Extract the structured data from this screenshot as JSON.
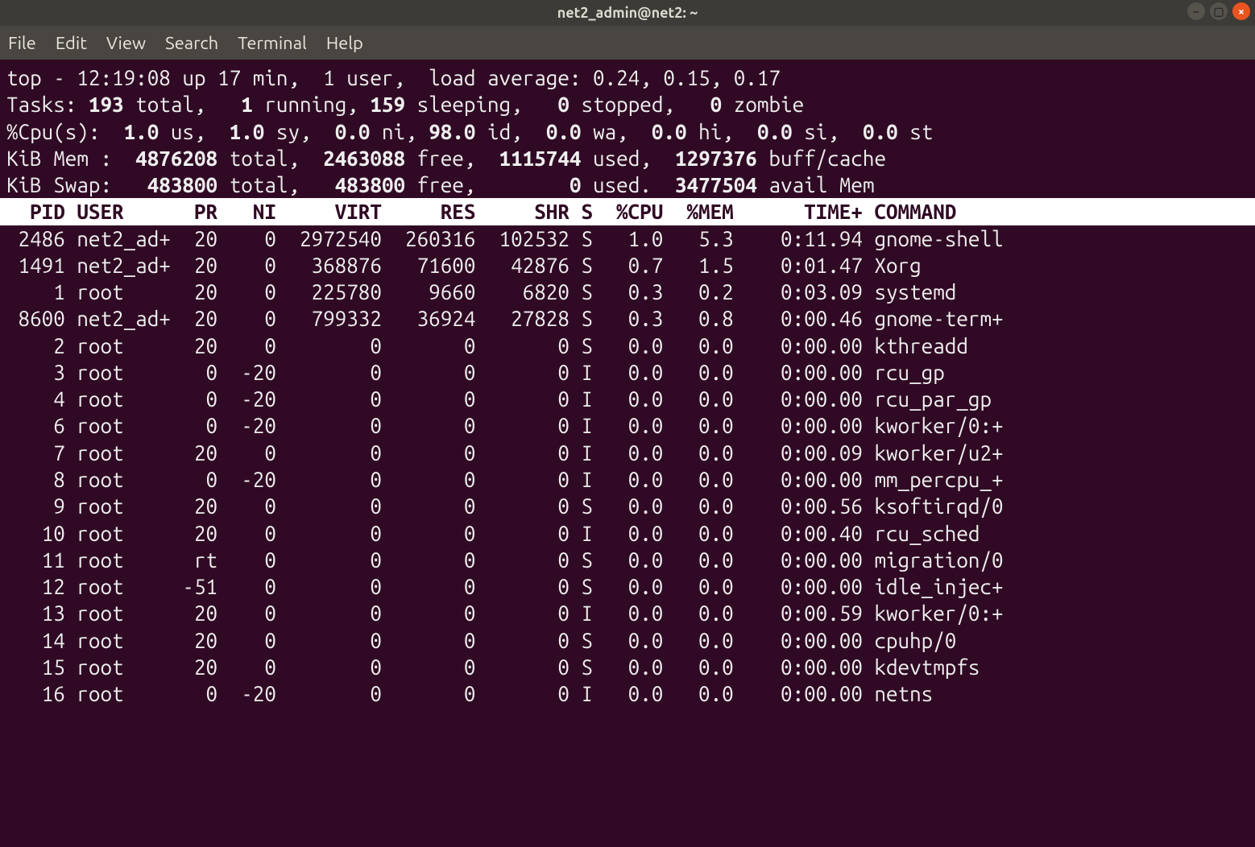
{
  "window": {
    "title": "net2_admin@net2: ~",
    "controls": {
      "minimize_tooltip": "Minimize",
      "maximize_tooltip": "Maximize",
      "close_tooltip": "Close"
    }
  },
  "menubar": [
    "File",
    "Edit",
    "View",
    "Search",
    "Terminal",
    "Help"
  ],
  "top": {
    "summary": {
      "time": "12:19:08",
      "uptime": "17 min",
      "users": "1",
      "load_avg": [
        "0.24",
        "0.15",
        "0.17"
      ]
    },
    "tasks": {
      "total": "193",
      "running": "1",
      "sleeping": "159",
      "stopped": "0",
      "zombie": "0"
    },
    "cpu": {
      "us": "1.0",
      "sy": "1.0",
      "ni": "0.0",
      "id": "98.0",
      "wa": "0.0",
      "hi": "0.0",
      "si": "0.0",
      "st": "0.0"
    },
    "mem": {
      "total": "4876208",
      "free": "2463088",
      "used": "1115744",
      "buff_cache": "1297376"
    },
    "swap": {
      "total": "483800",
      "free": "483800",
      "used": "0",
      "avail_mem": "3477504"
    },
    "columns": [
      "PID",
      "USER",
      "PR",
      "NI",
      "VIRT",
      "RES",
      "SHR",
      "S",
      "%CPU",
      "%MEM",
      "TIME+",
      "COMMAND"
    ],
    "processes": [
      {
        "pid": "2486",
        "user": "net2_ad+",
        "pr": "20",
        "ni": "0",
        "virt": "2972540",
        "res": "260316",
        "shr": "102532",
        "s": "S",
        "cpu": "1.0",
        "mem": "5.3",
        "time": "0:11.94",
        "command": "gnome-shell"
      },
      {
        "pid": "1491",
        "user": "net2_ad+",
        "pr": "20",
        "ni": "0",
        "virt": "368876",
        "res": "71600",
        "shr": "42876",
        "s": "S",
        "cpu": "0.7",
        "mem": "1.5",
        "time": "0:01.47",
        "command": "Xorg"
      },
      {
        "pid": "1",
        "user": "root",
        "pr": "20",
        "ni": "0",
        "virt": "225780",
        "res": "9660",
        "shr": "6820",
        "s": "S",
        "cpu": "0.3",
        "mem": "0.2",
        "time": "0:03.09",
        "command": "systemd"
      },
      {
        "pid": "8600",
        "user": "net2_ad+",
        "pr": "20",
        "ni": "0",
        "virt": "799332",
        "res": "36924",
        "shr": "27828",
        "s": "S",
        "cpu": "0.3",
        "mem": "0.8",
        "time": "0:00.46",
        "command": "gnome-term+"
      },
      {
        "pid": "2",
        "user": "root",
        "pr": "20",
        "ni": "0",
        "virt": "0",
        "res": "0",
        "shr": "0",
        "s": "S",
        "cpu": "0.0",
        "mem": "0.0",
        "time": "0:00.00",
        "command": "kthreadd"
      },
      {
        "pid": "3",
        "user": "root",
        "pr": "0",
        "ni": "-20",
        "virt": "0",
        "res": "0",
        "shr": "0",
        "s": "I",
        "cpu": "0.0",
        "mem": "0.0",
        "time": "0:00.00",
        "command": "rcu_gp"
      },
      {
        "pid": "4",
        "user": "root",
        "pr": "0",
        "ni": "-20",
        "virt": "0",
        "res": "0",
        "shr": "0",
        "s": "I",
        "cpu": "0.0",
        "mem": "0.0",
        "time": "0:00.00",
        "command": "rcu_par_gp"
      },
      {
        "pid": "6",
        "user": "root",
        "pr": "0",
        "ni": "-20",
        "virt": "0",
        "res": "0",
        "shr": "0",
        "s": "I",
        "cpu": "0.0",
        "mem": "0.0",
        "time": "0:00.00",
        "command": "kworker/0:+"
      },
      {
        "pid": "7",
        "user": "root",
        "pr": "20",
        "ni": "0",
        "virt": "0",
        "res": "0",
        "shr": "0",
        "s": "I",
        "cpu": "0.0",
        "mem": "0.0",
        "time": "0:00.09",
        "command": "kworker/u2+"
      },
      {
        "pid": "8",
        "user": "root",
        "pr": "0",
        "ni": "-20",
        "virt": "0",
        "res": "0",
        "shr": "0",
        "s": "I",
        "cpu": "0.0",
        "mem": "0.0",
        "time": "0:00.00",
        "command": "mm_percpu_+"
      },
      {
        "pid": "9",
        "user": "root",
        "pr": "20",
        "ni": "0",
        "virt": "0",
        "res": "0",
        "shr": "0",
        "s": "S",
        "cpu": "0.0",
        "mem": "0.0",
        "time": "0:00.56",
        "command": "ksoftirqd/0"
      },
      {
        "pid": "10",
        "user": "root",
        "pr": "20",
        "ni": "0",
        "virt": "0",
        "res": "0",
        "shr": "0",
        "s": "I",
        "cpu": "0.0",
        "mem": "0.0",
        "time": "0:00.40",
        "command": "rcu_sched"
      },
      {
        "pid": "11",
        "user": "root",
        "pr": "rt",
        "ni": "0",
        "virt": "0",
        "res": "0",
        "shr": "0",
        "s": "S",
        "cpu": "0.0",
        "mem": "0.0",
        "time": "0:00.00",
        "command": "migration/0"
      },
      {
        "pid": "12",
        "user": "root",
        "pr": "-51",
        "ni": "0",
        "virt": "0",
        "res": "0",
        "shr": "0",
        "s": "S",
        "cpu": "0.0",
        "mem": "0.0",
        "time": "0:00.00",
        "command": "idle_injec+"
      },
      {
        "pid": "13",
        "user": "root",
        "pr": "20",
        "ni": "0",
        "virt": "0",
        "res": "0",
        "shr": "0",
        "s": "I",
        "cpu": "0.0",
        "mem": "0.0",
        "time": "0:00.59",
        "command": "kworker/0:+"
      },
      {
        "pid": "14",
        "user": "root",
        "pr": "20",
        "ni": "0",
        "virt": "0",
        "res": "0",
        "shr": "0",
        "s": "S",
        "cpu": "0.0",
        "mem": "0.0",
        "time": "0:00.00",
        "command": "cpuhp/0"
      },
      {
        "pid": "15",
        "user": "root",
        "pr": "20",
        "ni": "0",
        "virt": "0",
        "res": "0",
        "shr": "0",
        "s": "S",
        "cpu": "0.0",
        "mem": "0.0",
        "time": "0:00.00",
        "command": "kdevtmpfs"
      },
      {
        "pid": "16",
        "user": "root",
        "pr": "0",
        "ni": "-20",
        "virt": "0",
        "res": "0",
        "shr": "0",
        "s": "I",
        "cpu": "0.0",
        "mem": "0.0",
        "time": "0:00.00",
        "command": "netns"
      }
    ]
  }
}
